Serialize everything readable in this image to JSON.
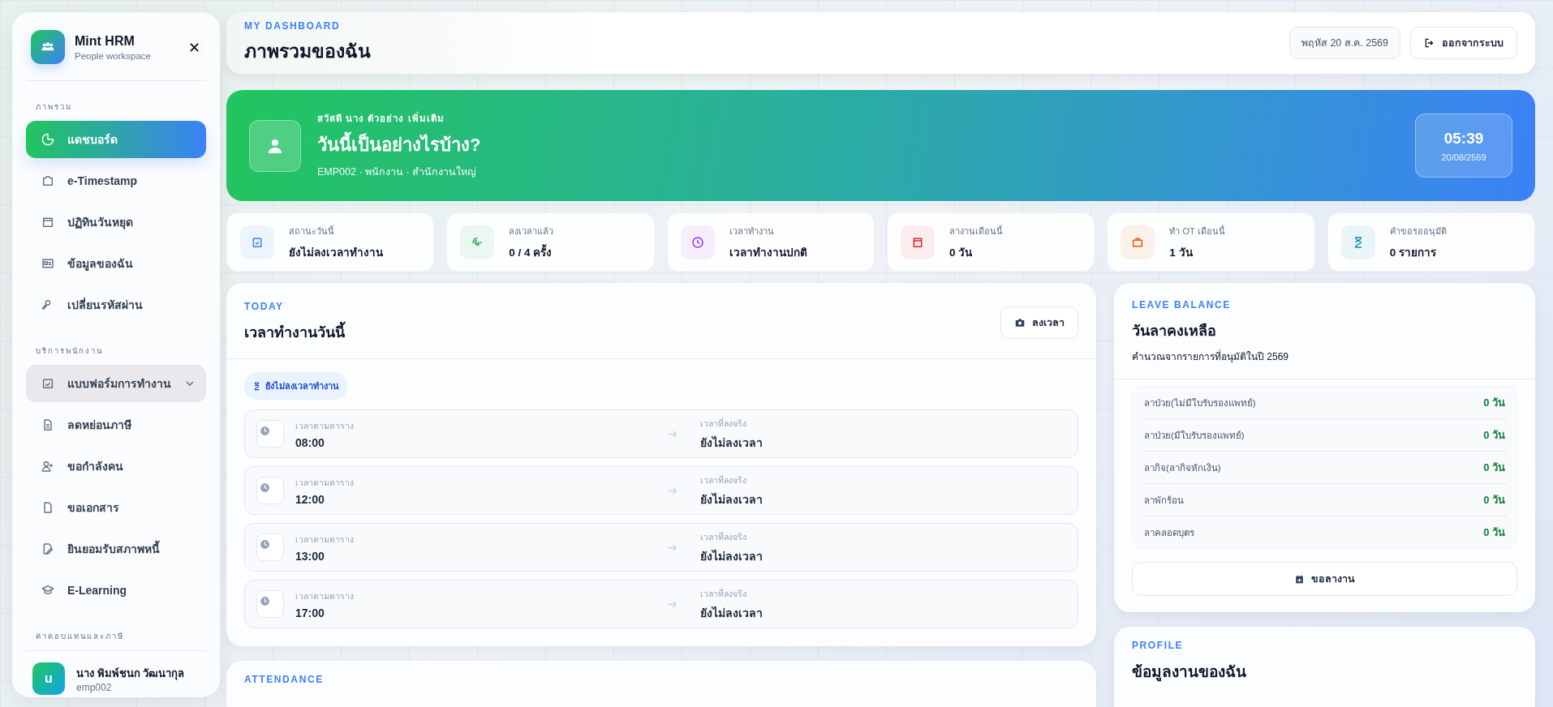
{
  "sidebar": {
    "brand": {
      "name": "Mint HRM",
      "subtitle": "People workspace"
    },
    "sections": [
      {
        "title": "ภาพรวม",
        "items": [
          {
            "label": "แดชบอร์ด",
            "selected": true,
            "kind": "link"
          },
          {
            "label": "e-Timestamp",
            "selected": false,
            "kind": "link"
          },
          {
            "label": "ปฏิทินวันหยุด",
            "selected": false,
            "kind": "link"
          },
          {
            "label": "ข้อมูลของฉัน",
            "selected": false,
            "kind": "link"
          },
          {
            "label": "เปลี่ยนรหัสผ่าน",
            "selected": false,
            "kind": "link"
          }
        ]
      },
      {
        "title": "บริการพนักงาน",
        "items": [
          {
            "label": "แบบฟอร์มการทำงาน",
            "selected": false,
            "kind": "group",
            "expanded": false
          },
          {
            "label": "ลดหย่อนภาษี",
            "selected": false,
            "kind": "link"
          },
          {
            "label": "ขอกำลังคน",
            "selected": false,
            "kind": "link"
          },
          {
            "label": "ขอเอกสาร",
            "selected": false,
            "kind": "link"
          },
          {
            "label": "ยินยอมรับสภาพหนี้",
            "selected": false,
            "kind": "link"
          },
          {
            "label": "E-Learning",
            "selected": false,
            "kind": "link"
          }
        ]
      },
      {
        "title": "ค่าตอบแทนและภาษี"
      }
    ],
    "user": {
      "initial": "u",
      "name": "นาง พิมพ์ชนก วัฒนากุล",
      "id": "emp002"
    }
  },
  "header": {
    "eyebrow": "MY DASHBOARD",
    "title": "ภาพรวมของฉัน",
    "date": "พฤหัส 20 ส.ค. 2569",
    "logout": "ออกจากระบบ"
  },
  "hero": {
    "greeting": "สวัสดี นาง ตัวอย่าง เพิ่มเติม",
    "title": "วันนี้เป็นอย่างไรบ้าง?",
    "meta": "EMP002 · พนักงาน · สำนักงานใหญ่",
    "time": "05:39",
    "date": "20/08/2569"
  },
  "stats": [
    {
      "label": "สถานะวันนี้",
      "value": "ยังไม่ลงเวลาทำงาน",
      "color": "#3b82f6"
    },
    {
      "label": "ลงเวลาแล้ว",
      "value": "0 / 4 ครั้ง",
      "color": "#16a34a"
    },
    {
      "label": "เวลาทำงาน",
      "value": "เวลาทำงานปกติ",
      "color": "#9333ea"
    },
    {
      "label": "ลางานเดือนนี้",
      "value": "0 วัน",
      "color": "#dc2626"
    },
    {
      "label": "ทำ OT เดือนนี้",
      "value": "1 วัน",
      "color": "#ea580c"
    },
    {
      "label": "คำขอรออนุมัติ",
      "value": "0 รายการ",
      "color": "#0891b2"
    }
  ],
  "today": {
    "eyebrow": "TODAY",
    "title": "เวลาทำงานวันนี้",
    "button": "ลงเวลา",
    "status": "ยังไม่ลงเวลาทำงาน",
    "rows": [
      {
        "scheduled_label": "เวลาตามตาราง",
        "scheduled": "08:00",
        "actual_label": "เวลาที่ลงจริง",
        "actual": "ยังไม่ลงเวลา"
      },
      {
        "scheduled_label": "เวลาตามตาราง",
        "scheduled": "12:00",
        "actual_label": "เวลาที่ลงจริง",
        "actual": "ยังไม่ลงเวลา"
      },
      {
        "scheduled_label": "เวลาตามตาราง",
        "scheduled": "13:00",
        "actual_label": "เวลาที่ลงจริง",
        "actual": "ยังไม่ลงเวลา"
      },
      {
        "scheduled_label": "เวลาตามตาราง",
        "scheduled": "17:00",
        "actual_label": "เวลาที่ลงจริง",
        "actual": "ยังไม่ลงเวลา"
      }
    ]
  },
  "attendance": {
    "eyebrow": "ATTENDANCE"
  },
  "leave": {
    "eyebrow": "LEAVE BALANCE",
    "title": "วันลาคงเหลือ",
    "subtitle": "คำนวณจากรายการที่อนุมัติในปี 2569",
    "items": [
      {
        "type": "ลาป่วย(ไม่มีใบรับรองแพทย์)",
        "balance": "0 วัน"
      },
      {
        "type": "ลาป่วย(มีใบรับรองแพทย์)",
        "balance": "0 วัน"
      },
      {
        "type": "ลากิจ(ลากิจหักเงิน)",
        "balance": "0 วัน"
      },
      {
        "type": "ลาพักร้อน",
        "balance": "0 วัน"
      },
      {
        "type": "ลาคลอดบุตร",
        "balance": "0 วัน"
      }
    ],
    "button": "ขอลางาน"
  },
  "profile": {
    "eyebrow": "PROFILE",
    "title": "ข้อมูลงานของฉัน"
  }
}
